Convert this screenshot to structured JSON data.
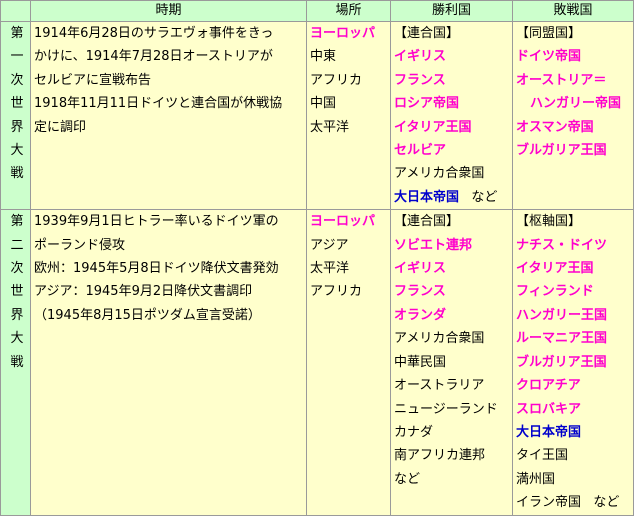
{
  "headers": {
    "period": "時期",
    "place": "場所",
    "victors": "勝利国",
    "defeated": "敗戦国"
  },
  "ww1": {
    "name_chars": [
      "第",
      "一",
      "次",
      "世",
      "界",
      "大",
      "戦"
    ],
    "period_lines": [
      "1914年6月28日のサラエヴォ事件をきっ",
      "かけに、1914年7月28日オーストリアが",
      "セルビアに宣戦布告",
      "1918年11月11日ドイツと連合国が休戦協",
      "定に調印"
    ],
    "places": [
      "ヨーロッパ",
      "中東",
      "アフリカ",
      "中国",
      "太平洋"
    ],
    "victors_heading": "【連合国】",
    "victors_bold": [
      "イギリス",
      "フランス",
      "ロシア帝国",
      "イタリア王国",
      "セルビア"
    ],
    "victors_plain": "アメリカ合衆国",
    "victors_japan": "大日本帝国",
    "victors_etc": "など",
    "defeated_heading": "【同盟国】",
    "defeated": [
      "ドイツ帝国",
      "オーストリア＝",
      "ハンガリー帝国",
      "オスマン帝国",
      "ブルガリア王国"
    ]
  },
  "ww2": {
    "name_chars": [
      "第",
      "二",
      "次",
      "世",
      "界",
      "大",
      "戦"
    ],
    "period_lines": [
      "1939年9月1日ヒトラー率いるドイツ軍の",
      "ポーランド侵攻",
      "欧州：1945年5月8日ドイツ降伏文書発効",
      "アジア：1945年9月2日降伏文書調印",
      "（1945年8月15日ポツダム宣言受諾）"
    ],
    "places": [
      "ヨーロッパ",
      "アジア",
      "太平洋",
      "アフリカ"
    ],
    "victors_heading": "【連合国】",
    "victors_bold": [
      "ソビエト連邦",
      "イギリス",
      "フランス",
      "オランダ"
    ],
    "victors_plain": [
      "アメリカ合衆国",
      "中華民国",
      "オーストラリア",
      "ニュージーランド",
      "カナダ",
      "南アフリカ連邦",
      "など"
    ],
    "defeated_heading": "【枢軸国】",
    "defeated_bold": [
      "ナチス・ドイツ",
      "イタリア王国",
      "フィンランド",
      "ハンガリー王国",
      "ルーマニア王国",
      "ブルガリア王国",
      "クロアチア",
      "スロバキア"
    ],
    "defeated_japan": "大日本帝国",
    "defeated_plain": [
      "タイ王国",
      "満州国"
    ],
    "defeated_last": "イラン帝国",
    "defeated_etc": "など"
  },
  "colors": {
    "header_bg": "#ccffcc",
    "cell_bg": "#ffffcc",
    "highlight": "#ff00cc",
    "japan": "#0000cc"
  }
}
